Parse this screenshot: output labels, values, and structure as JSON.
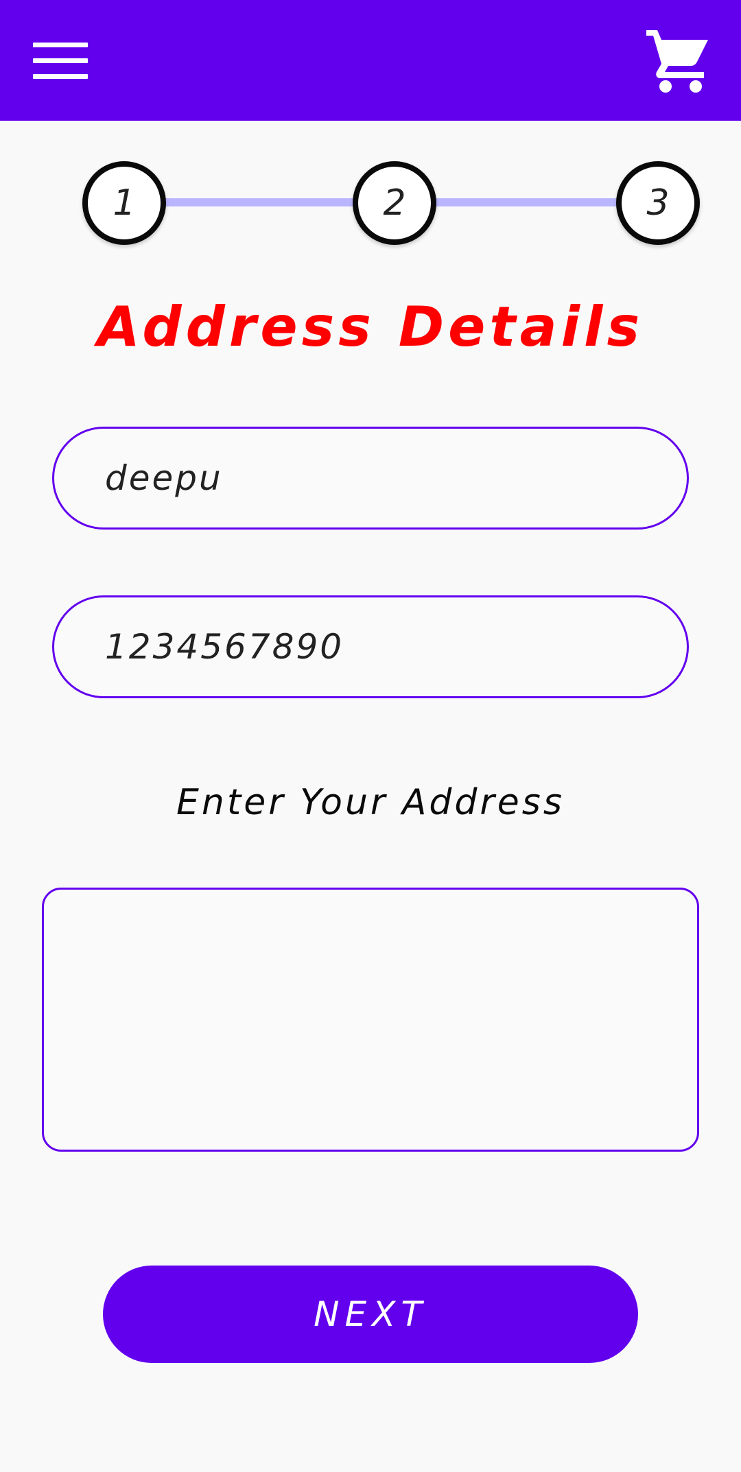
{
  "appbar": {
    "menu_icon": "hamburger-menu-icon",
    "cart_icon": "shopping-cart-icon",
    "background": "#6200ee"
  },
  "stepper": {
    "steps": [
      "1",
      "2",
      "3"
    ],
    "line_color": "#b9b6ff"
  },
  "page": {
    "title": "Address Details",
    "title_color": "#ff0000"
  },
  "form": {
    "name_value": "deepu",
    "phone_value": "1234567890",
    "address_label": "Enter Your Address",
    "address_value": ""
  },
  "actions": {
    "next_label": "NEXT"
  }
}
